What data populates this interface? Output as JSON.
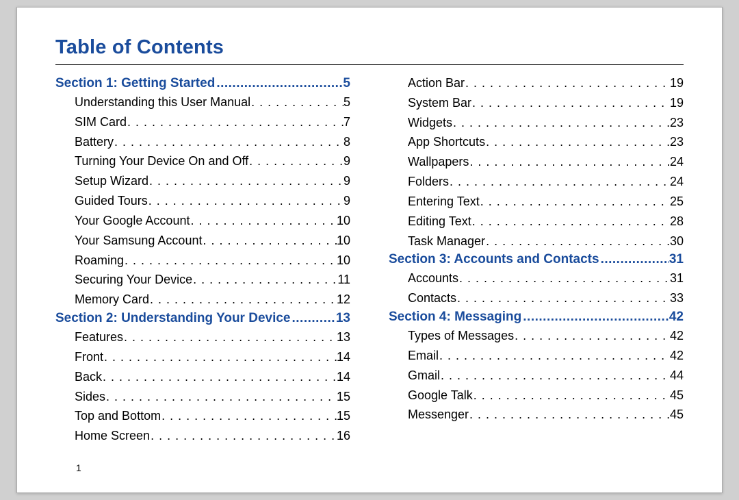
{
  "title": "Table of Contents",
  "page_number": "1",
  "columns": [
    [
      {
        "type": "section",
        "label": "Section 1:  Getting Started",
        "page": "5"
      },
      {
        "type": "entry",
        "label": "Understanding this User Manual",
        "page": "5"
      },
      {
        "type": "entry",
        "label": "SIM Card",
        "page": "7"
      },
      {
        "type": "entry",
        "label": "Battery",
        "page": "8"
      },
      {
        "type": "entry",
        "label": "Turning Your Device On and Off",
        "page": "9"
      },
      {
        "type": "entry",
        "label": "Setup Wizard",
        "page": "9"
      },
      {
        "type": "entry",
        "label": "Guided Tours",
        "page": "9"
      },
      {
        "type": "entry",
        "label": "Your Google Account",
        "page": "10"
      },
      {
        "type": "entry",
        "label": "Your Samsung Account",
        "page": "10"
      },
      {
        "type": "entry",
        "label": "Roaming",
        "page": "10"
      },
      {
        "type": "entry",
        "label": "Securing Your Device",
        "page": "11"
      },
      {
        "type": "entry",
        "label": "Memory Card",
        "page": "12"
      },
      {
        "type": "section",
        "label": "Section 2:  Understanding Your Device",
        "page": "13"
      },
      {
        "type": "entry",
        "label": "Features",
        "page": "13"
      },
      {
        "type": "entry",
        "label": "Front",
        "page": "14"
      },
      {
        "type": "entry",
        "label": "Back",
        "page": "14"
      },
      {
        "type": "entry",
        "label": "Sides",
        "page": "15"
      },
      {
        "type": "entry",
        "label": "Top and Bottom",
        "page": "15"
      },
      {
        "type": "entry",
        "label": "Home Screen",
        "page": "16"
      }
    ],
    [
      {
        "type": "entry",
        "label": "Action Bar",
        "page": "19"
      },
      {
        "type": "entry",
        "label": "System Bar",
        "page": "19"
      },
      {
        "type": "entry",
        "label": "Widgets",
        "page": "23"
      },
      {
        "type": "entry",
        "label": "App Shortcuts",
        "page": "23"
      },
      {
        "type": "entry",
        "label": "Wallpapers",
        "page": "24"
      },
      {
        "type": "entry",
        "label": "Folders",
        "page": "24"
      },
      {
        "type": "entry",
        "label": "Entering Text",
        "page": "25"
      },
      {
        "type": "entry",
        "label": "Editing Text",
        "page": "28"
      },
      {
        "type": "entry",
        "label": "Task Manager",
        "page": "30"
      },
      {
        "type": "section",
        "label": "Section 3:  Accounts and Contacts",
        "page": "31"
      },
      {
        "type": "entry",
        "label": "Accounts",
        "page": "31"
      },
      {
        "type": "entry",
        "label": "Contacts",
        "page": "33"
      },
      {
        "type": "section",
        "label": "Section 4:  Messaging",
        "page": "42"
      },
      {
        "type": "entry",
        "label": "Types of Messages",
        "page": "42"
      },
      {
        "type": "entry",
        "label": "Email",
        "page": "42"
      },
      {
        "type": "entry",
        "label": "Gmail",
        "page": "44"
      },
      {
        "type": "entry",
        "label": "Google Talk",
        "page": "45"
      },
      {
        "type": "entry",
        "label": "Messenger",
        "page": "45"
      }
    ]
  ]
}
